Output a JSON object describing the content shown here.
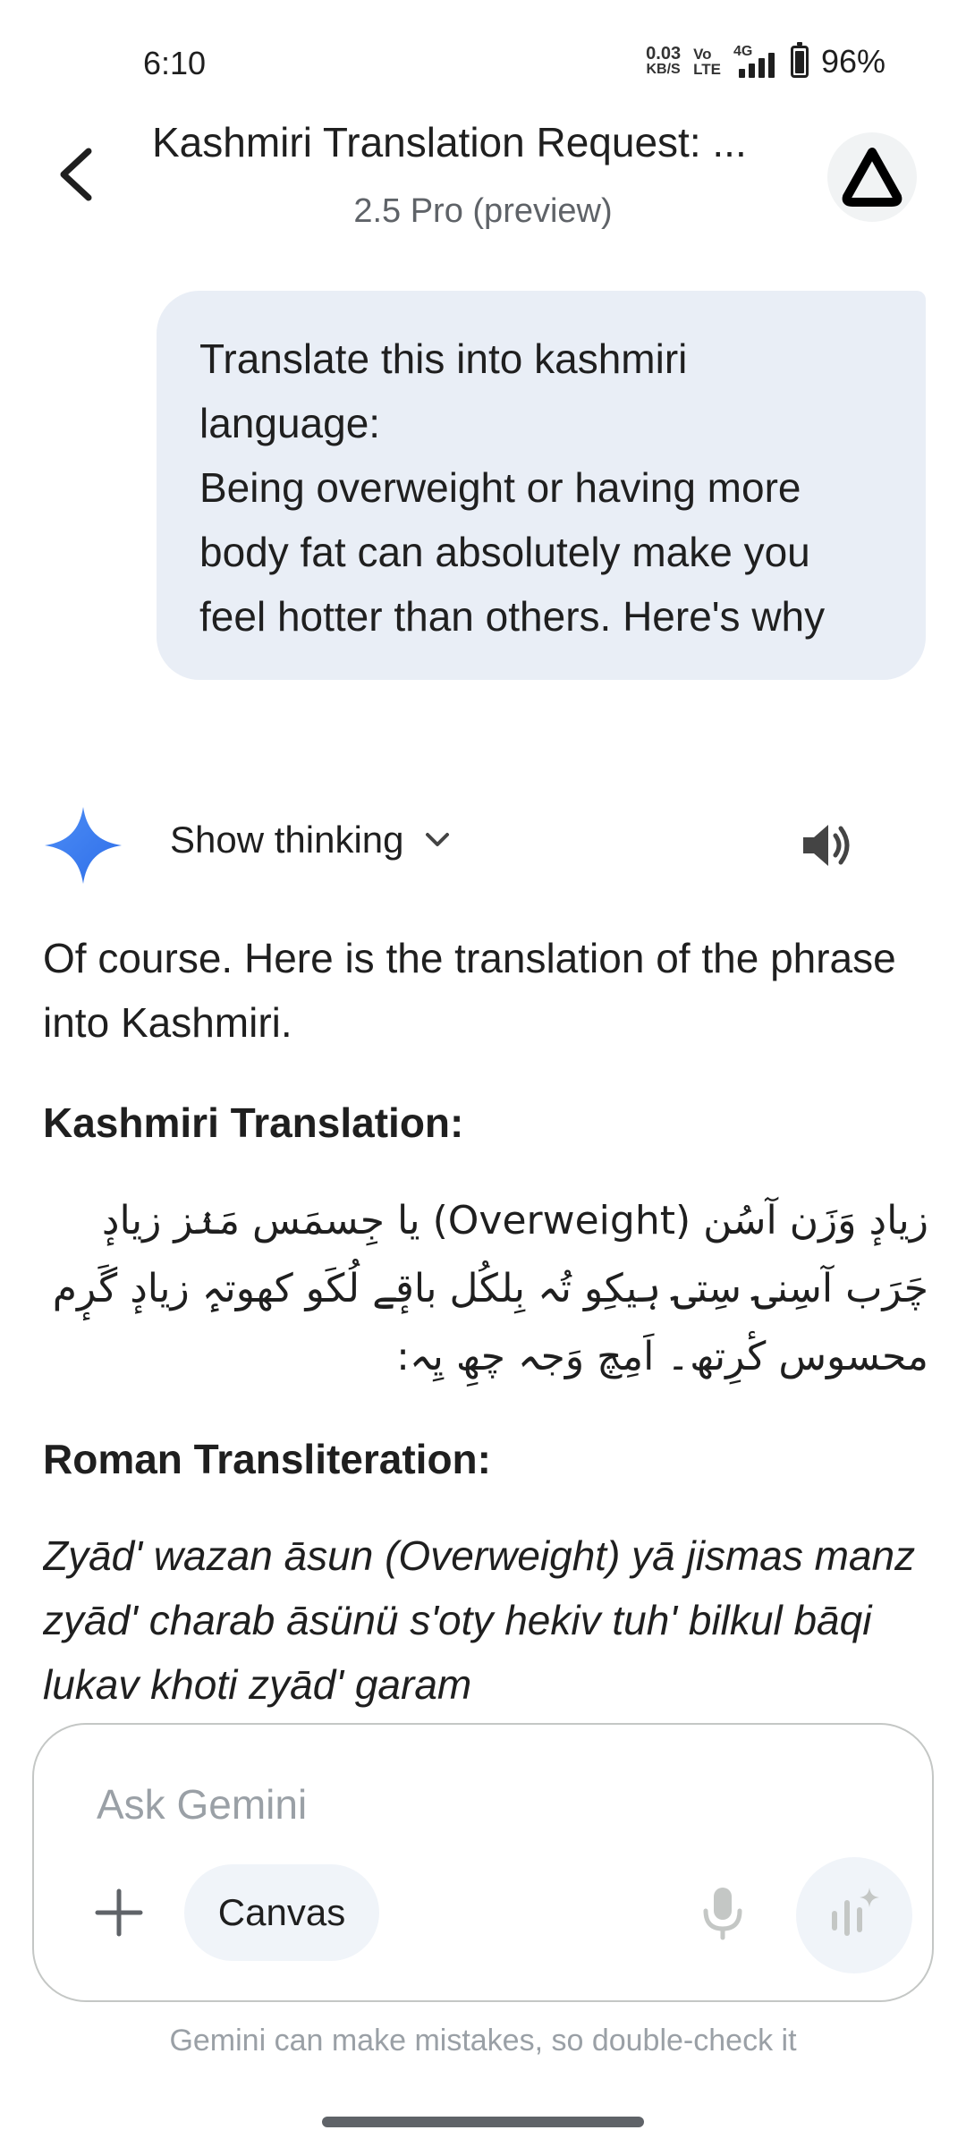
{
  "status_bar": {
    "time": "6:10",
    "net_speed_value": "0.03",
    "net_speed_unit": "KB/S",
    "volte_top": "Vo",
    "volte_bottom": "LTE",
    "network_type": "4G",
    "battery_percent": "96%",
    "battery_level": 0.96
  },
  "header": {
    "title": "Kashmiri Translation Request: ...",
    "subtitle": "2.5 Pro (preview)",
    "back_icon": "chevron-left-icon",
    "avatar_icon": "account-logo-icon"
  },
  "user_message": {
    "text": "Translate this into kashmiri\nlanguage:\nBeing overweight or having more body fat can absolutely make you feel hotter than others. Here's why"
  },
  "response": {
    "show_thinking_label": "Show thinking",
    "intro": "Of course. Here is the translation of the phrase into Kashmiri.",
    "kashmiri_heading": "Kashmiri Translation:",
    "kashmiri_text": "زیادٕ وَزَن آسُن (Overweight) یا جِسمَس مَنٛز زیادٕ چَرَب آسِنۍ سِتۍ ہیکِو تُہ بِلکُل باقٕے لُکَو کھوتہٕ زیادٕ گَرٕم محسوس کٔرِتھ۔ اَمِچ وَجہ چھِ یِہ:",
    "roman_heading": "Roman Transliteration:",
    "roman_text": "Zyād' wazan āsun (Overweight) yā jismas manz zyād' charab āsünü s'oty hekiv tuh' bilkul bāqi lukav khoti zyād' garam"
  },
  "composer": {
    "placeholder": "Ask Gemini",
    "canvas_label": "Canvas"
  },
  "footer": {
    "disclaimer": "Gemini can make mistakes, so double-check it"
  },
  "colors": {
    "bubble": "#e9eef6",
    "accent_spark": "#4285f4",
    "chip": "#f0f4f9",
    "muted": "#9aa0a6"
  }
}
